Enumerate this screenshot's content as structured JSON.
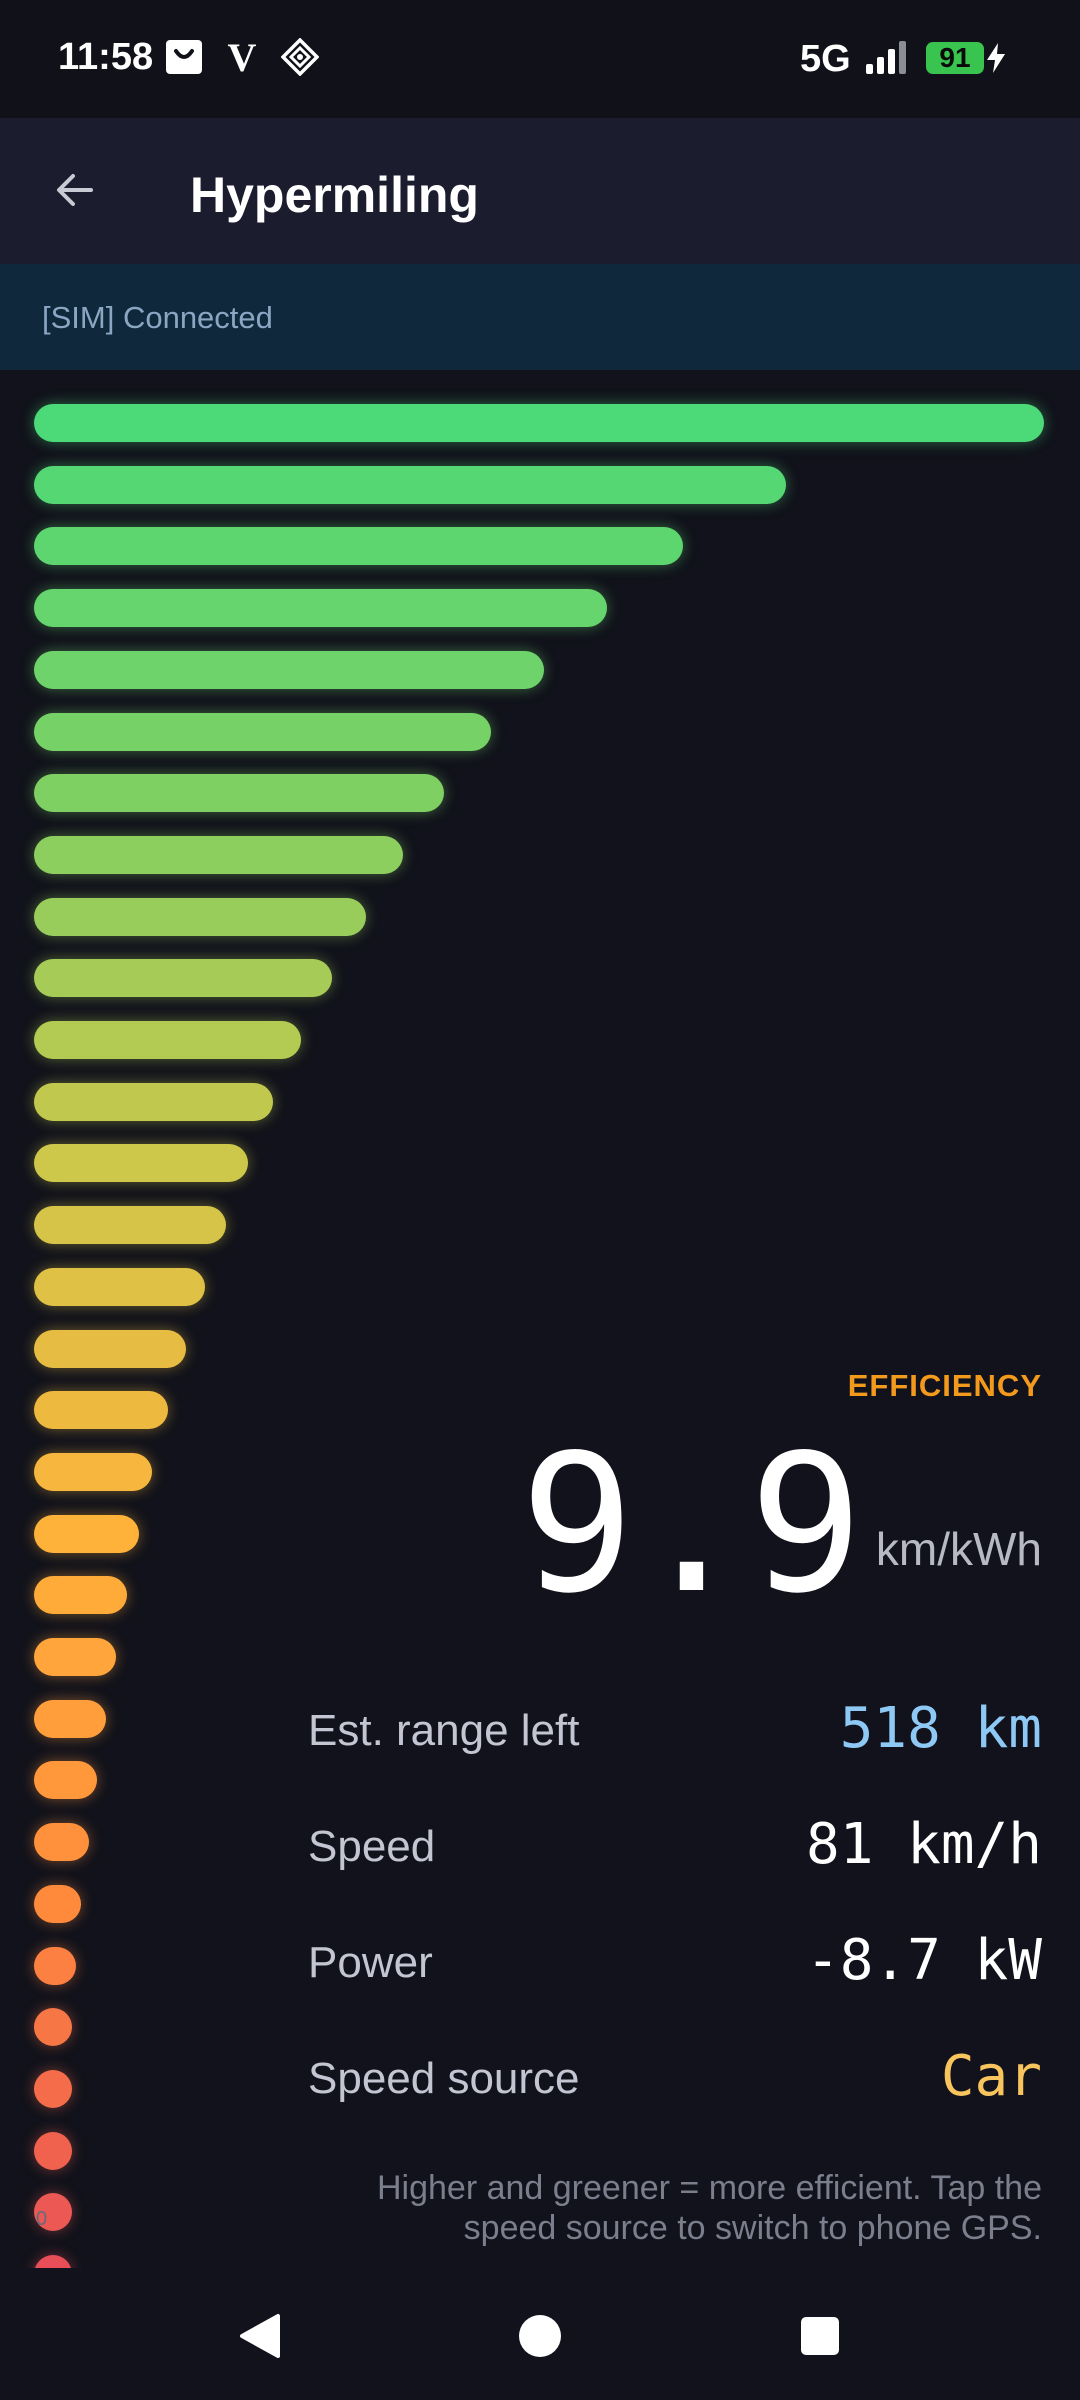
{
  "status_bar": {
    "time": "11:58",
    "network": "5G",
    "battery": "91",
    "icons": [
      "shopping-bag-icon",
      "v-app-icon",
      "tiktok-diamond-icon",
      "signal-icon",
      "charging-bolt-icon"
    ]
  },
  "app_bar": {
    "title": "Hypermiling",
    "back_icon": "arrow-left-icon"
  },
  "connection": {
    "status": "[SIM] Connected"
  },
  "chart_data": {
    "type": "bar",
    "orientation": "horizontal",
    "values": [
      1.0,
      0.745,
      0.643,
      0.567,
      0.505,
      0.452,
      0.406,
      0.365,
      0.329,
      0.295,
      0.264,
      0.237,
      0.212,
      0.19,
      0.169,
      0.15,
      0.133,
      0.117,
      0.104,
      0.092,
      0.081,
      0.071,
      0.062,
      0.054,
      0.047,
      0.042,
      0.037,
      0.033,
      0.031,
      0.029,
      0.029
    ],
    "color_scale": [
      "#e84e57",
      "#ff8a3c",
      "#ffb23a",
      "#cdc84a",
      "#7fd063",
      "#4cd977"
    ],
    "axis_label": "0"
  },
  "efficiency": {
    "label": "EFFICIENCY",
    "value": "9.9",
    "unit": "km/kWh"
  },
  "stats": [
    {
      "label": "Est. range left",
      "value": "518 km",
      "color": "#8ec9f5"
    },
    {
      "label": "Speed",
      "value": "81 km/h",
      "color": "#ffffff"
    },
    {
      "label": "Power",
      "value": "-8.7 kW",
      "color": "#ffffff"
    },
    {
      "label": "Speed source",
      "value": "Car",
      "color": "#f7c45e"
    }
  ],
  "hint": "Higher and greener = more efficient. Tap the speed source to switch to phone GPS.",
  "nav_bar": {
    "icons": [
      "nav-back-icon",
      "nav-home-icon",
      "nav-recents-icon"
    ]
  }
}
